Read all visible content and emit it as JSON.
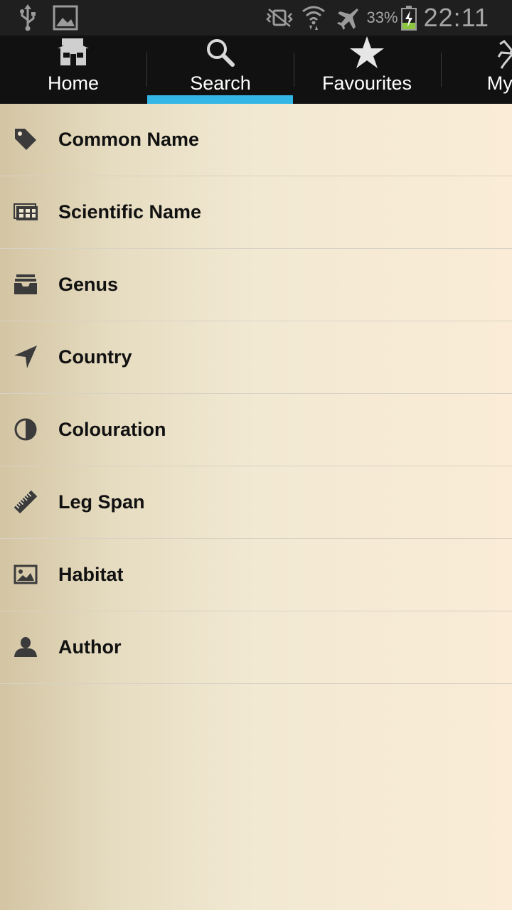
{
  "status_bar": {
    "battery_percent": "33%",
    "time": "22:11"
  },
  "tabs": [
    {
      "label": "Home",
      "icon": "home-icon"
    },
    {
      "label": "Search",
      "icon": "search-icon",
      "selected": true
    },
    {
      "label": "Favourites",
      "icon": "star-icon"
    },
    {
      "label": "My Sp",
      "icon": "spider-icon"
    }
  ],
  "search_fields": [
    {
      "label": "Common Name",
      "icon": "tag-icon"
    },
    {
      "label": "Scientific Name",
      "icon": "cards-icon"
    },
    {
      "label": "Genus",
      "icon": "inbox-icon"
    },
    {
      "label": "Country",
      "icon": "location-arrow-icon"
    },
    {
      "label": "Colouration",
      "icon": "half-circle-icon"
    },
    {
      "label": "Leg Span",
      "icon": "ruler-icon"
    },
    {
      "label": "Habitat",
      "icon": "picture-icon"
    },
    {
      "label": "Author",
      "icon": "person-icon"
    }
  ],
  "colors": {
    "tab_indicator": "#33b5e5",
    "tab_bar": "#111111",
    "status_bar": "#1f1f1f"
  }
}
